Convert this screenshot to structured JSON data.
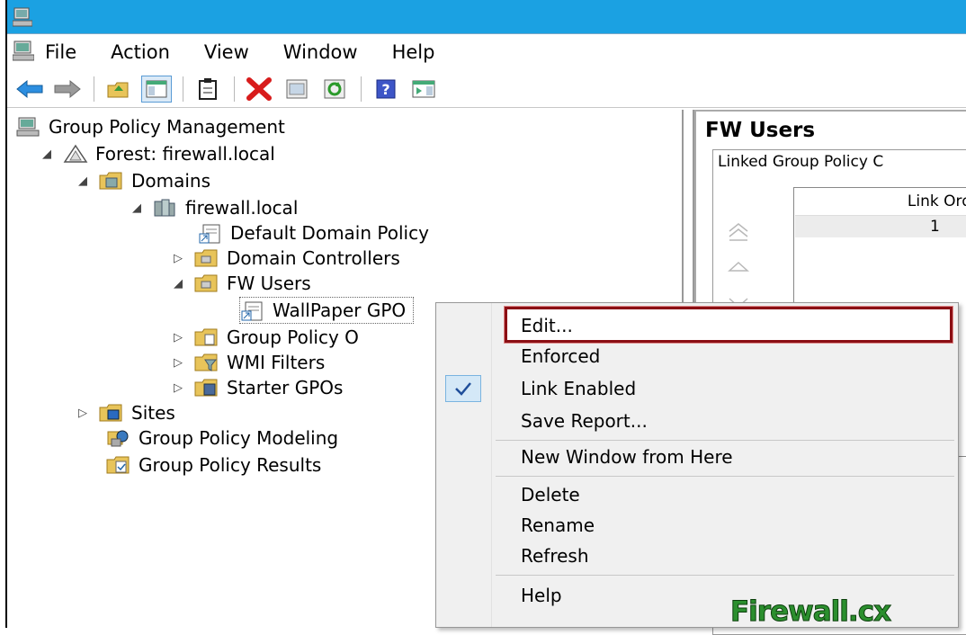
{
  "menubar": {
    "items": [
      "File",
      "Action",
      "View",
      "Window",
      "Help"
    ]
  },
  "toolbar": {
    "icons": [
      "back-arrow-icon",
      "forward-arrow-icon",
      "up-folder-icon",
      "show-hide-tree-icon",
      "clipboard-icon",
      "delete-icon",
      "properties-icon",
      "refresh-icon",
      "help-icon",
      "action-pane-icon"
    ]
  },
  "tree": {
    "root": "Group Policy Management",
    "forest": "Forest: firewall.local",
    "domains": "Domains",
    "domain": "firewall.local",
    "default_policy": "Default Domain Policy",
    "domain_controllers": "Domain Controllers",
    "fw_users": "FW Users",
    "wallpaper": "WallPaper GPO",
    "gpo_objects": "Group Policy O",
    "wmi": "WMI Filters",
    "starter": "Starter GPOs",
    "sites": "Sites",
    "modeling": "Group Policy Modeling",
    "results": "Group Policy Results"
  },
  "right_pane": {
    "title": "FW Users",
    "tab": "Linked Group Policy C",
    "column": "Link Ord",
    "row_value": "1"
  },
  "context_menu": {
    "items": {
      "edit": "Edit...",
      "enforced": "Enforced",
      "link_enabled": "Link Enabled",
      "save_report": "Save Report...",
      "new_window": "New Window from Here",
      "delete": "Delete",
      "rename": "Rename",
      "refresh": "Refresh",
      "help": "Help"
    },
    "checked": "Link Enabled"
  },
  "watermark": "Firewall.cx",
  "colors": {
    "titlebar": "#1ba1e2",
    "highlight_border": "#8b0f14",
    "check_bg": "#d4e8f7"
  }
}
